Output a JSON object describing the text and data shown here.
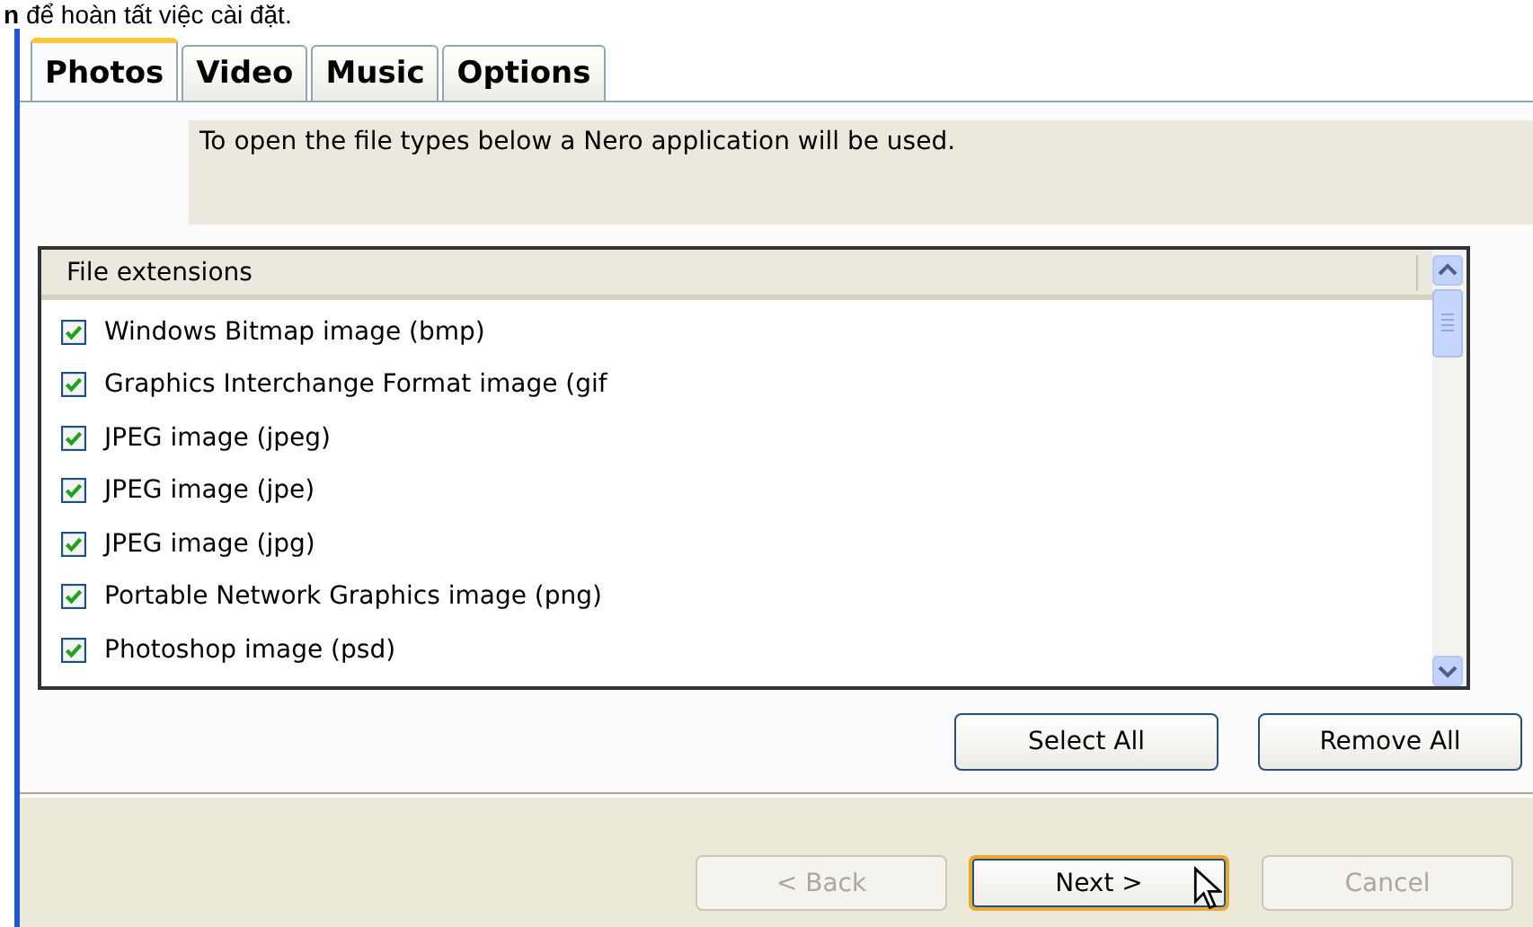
{
  "caption": "**n** để hoàn tất việc cài đặt.",
  "tabs": [
    {
      "label": "Photos",
      "selected": true
    },
    {
      "label": "Video",
      "selected": false
    },
    {
      "label": "Music",
      "selected": false
    },
    {
      "label": "Options",
      "selected": false
    }
  ],
  "info": "To open the file types below a Nero application will be used.",
  "list": {
    "header": "File extensions",
    "items": [
      {
        "label": "Windows Bitmap image (bmp)",
        "checked": true
      },
      {
        "label": "Graphics Interchange Format image (gif",
        "checked": true
      },
      {
        "label": "JPEG image (jpeg)",
        "checked": true
      },
      {
        "label": "JPEG image (jpe)",
        "checked": true
      },
      {
        "label": "JPEG image (jpg)",
        "checked": true
      },
      {
        "label": "Portable Network Graphics image (png)",
        "checked": true
      },
      {
        "label": "Photoshop image (psd)",
        "checked": true
      }
    ]
  },
  "list_buttons": [
    "Select All",
    "Remove All"
  ],
  "wizard_buttons": [
    {
      "label": "< Back",
      "disabled": true,
      "focused": false
    },
    {
      "label": "Next >",
      "disabled": false,
      "focused": true
    },
    {
      "label": "Cancel",
      "disabled": true,
      "focused": false
    }
  ]
}
